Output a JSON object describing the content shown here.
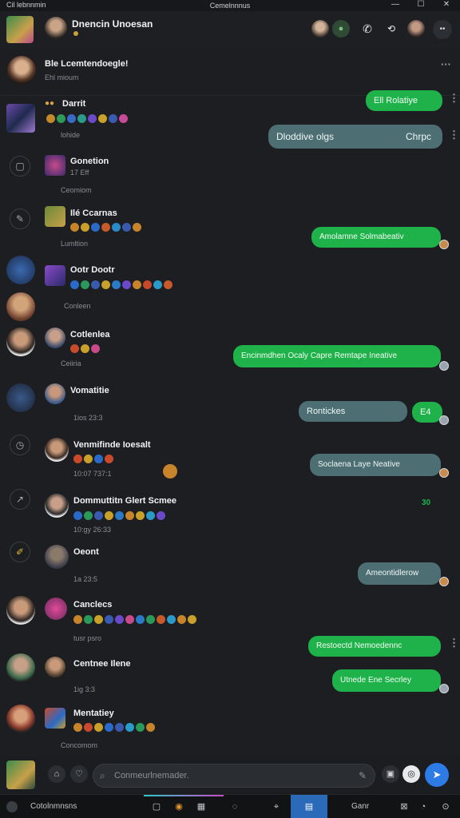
{
  "titlebar": {
    "left_label": "Cil lebnnmin",
    "center_title": "Cemelnnnus",
    "controls": [
      "—",
      "☐",
      "✕"
    ]
  },
  "header": {
    "contact_name": "Dnencin Unoesan",
    "icons": [
      "video-call-icon",
      "phone-icon",
      "camera-switch-icon",
      "profile-icon",
      "more-icon"
    ]
  },
  "pinned": {
    "name": "Ble Lcemtendoegle!",
    "status": "Ehl mioum"
  },
  "messages": [
    {
      "name": "Darrit",
      "status": "lohide",
      "bubble": "Ell Rolatiye",
      "bubble_color": "#1fb24a"
    },
    {
      "name": "",
      "status": "",
      "bubble": "Dloddive olgs",
      "bubble2": "Chrpc",
      "bubble_color": "#4d6f73"
    },
    {
      "name": "Gonetion",
      "status": "17 Eff",
      "sub": "Ceomiom"
    },
    {
      "name": "Ilé Ccarnas",
      "status": "Lumltion",
      "bubble": "Amolamne Solmabeativ",
      "bubble_color": "#1fb24a"
    },
    {
      "name": "Ootr Dootr",
      "status": "Conleen"
    },
    {
      "name": "Cotlenlea",
      "status": "Ceiiria",
      "bubble": "Encinmdhen Ocaly Capre Remtape Ineative",
      "bubble_color": "#1fb24a"
    },
    {
      "name": "Vomatitie",
      "status": "1ios 23:3",
      "bubble": "Rontickes",
      "bubble2": "E4",
      "bubble_color": "#4d6f73"
    },
    {
      "name": "Venmifinde Ioesalt",
      "status": "10:07 737:1",
      "bubble": "Soclaena Laye Neative",
      "bubble_color": "#4d6f73"
    },
    {
      "name": "Dommuttitn Glert Scmee",
      "status": "10:gy 26:33",
      "tag": "30"
    },
    {
      "name": "Oeont",
      "status": "1a 23:5",
      "bubble": "Ameontidlerow",
      "bubble_color": "#4d6f73"
    },
    {
      "name": "Canclecs",
      "status": "tusr psro",
      "bubble": "Restoectd Nemoedennc",
      "bubble_color": "#1fb24a"
    },
    {
      "name": "Centnee Ilene",
      "status": "1ig 3:3",
      "bubble": "Utnede Ene Secrley",
      "bubble_color": "#1fb24a"
    },
    {
      "name": "Mentatiey",
      "status": "Concomom"
    }
  ],
  "input": {
    "placeholder": "Conmeurlnemader."
  },
  "taskbar": {
    "left_label": "Cotolnmnsns",
    "right_label": "Ganr"
  },
  "colors": {
    "accent_green": "#1fb24a",
    "bubble_teal": "#4d6f73",
    "send_blue": "#2d7be5",
    "background": "#1c1e22"
  }
}
